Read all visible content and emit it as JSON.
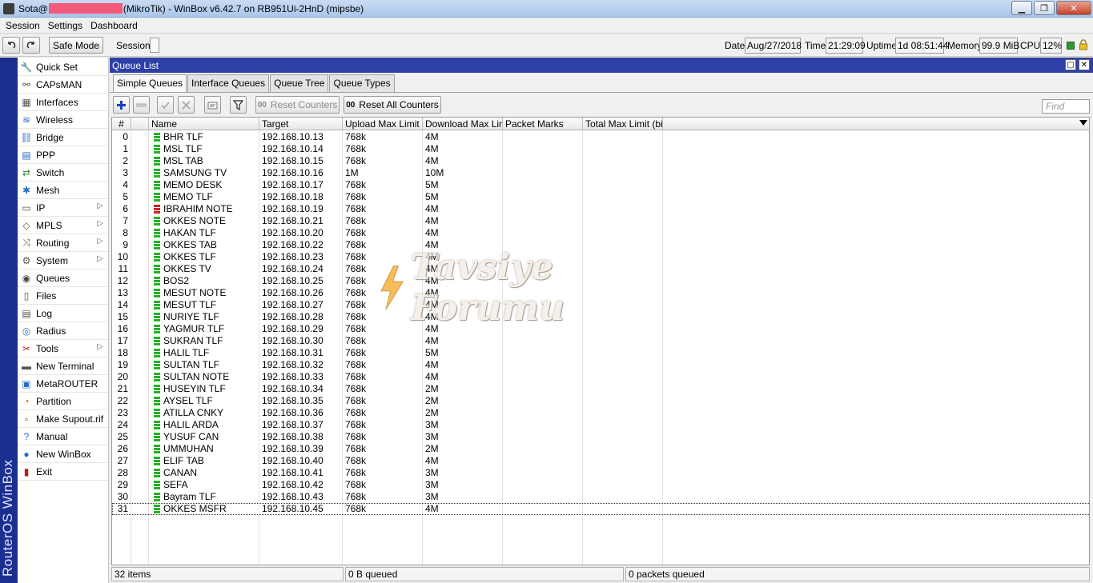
{
  "window": {
    "title_prefix": "Sota@",
    "title_suffix": "(MikroTik) - WinBox v6.42.7 on RB951Ui-2HnD (mipsbe)",
    "controls": [
      "minimize",
      "maximize",
      "close"
    ]
  },
  "menu": [
    "Session",
    "Settings",
    "Dashboard"
  ],
  "toolbar": {
    "safe_mode": "Safe Mode",
    "session_label": "Session:",
    "date_label": "Date:",
    "date": "Aug/27/2018",
    "time_label": "Time:",
    "time": "21:29:09",
    "uptime_label": "Uptime:",
    "uptime": "1d 08:51:44",
    "memory_label": "Memory:",
    "memory": "99.9 MiB",
    "cpu_label": "CPU:",
    "cpu": "12%"
  },
  "brand": "RouterOS WinBox",
  "sidebar": [
    {
      "label": "Quick Set",
      "icon": "quick-set-icon",
      "submenu": false
    },
    {
      "label": "CAPsMAN",
      "icon": "capsman-icon",
      "submenu": false
    },
    {
      "label": "Interfaces",
      "icon": "interfaces-icon",
      "submenu": false
    },
    {
      "label": "Wireless",
      "icon": "wireless-icon",
      "submenu": false
    },
    {
      "label": "Bridge",
      "icon": "bridge-icon",
      "submenu": false
    },
    {
      "label": "PPP",
      "icon": "ppp-icon",
      "submenu": false
    },
    {
      "label": "Switch",
      "icon": "switch-icon",
      "submenu": false
    },
    {
      "label": "Mesh",
      "icon": "mesh-icon",
      "submenu": false
    },
    {
      "label": "IP",
      "icon": "ip-icon",
      "submenu": true
    },
    {
      "label": "MPLS",
      "icon": "mpls-icon",
      "submenu": true
    },
    {
      "label": "Routing",
      "icon": "routing-icon",
      "submenu": true
    },
    {
      "label": "System",
      "icon": "system-icon",
      "submenu": true
    },
    {
      "label": "Queues",
      "icon": "queues-icon",
      "submenu": false
    },
    {
      "label": "Files",
      "icon": "files-icon",
      "submenu": false
    },
    {
      "label": "Log",
      "icon": "log-icon",
      "submenu": false
    },
    {
      "label": "Radius",
      "icon": "radius-icon",
      "submenu": false
    },
    {
      "label": "Tools",
      "icon": "tools-icon",
      "submenu": true
    },
    {
      "label": "New Terminal",
      "icon": "terminal-icon",
      "submenu": false
    },
    {
      "label": "MetaROUTER",
      "icon": "metarouter-icon",
      "submenu": false
    },
    {
      "label": "Partition",
      "icon": "partition-icon",
      "submenu": false
    },
    {
      "label": "Make Supout.rif",
      "icon": "supout-icon",
      "submenu": false
    },
    {
      "label": "Manual",
      "icon": "manual-icon",
      "submenu": false
    },
    {
      "label": "New WinBox",
      "icon": "winbox-icon",
      "submenu": false
    },
    {
      "label": "Exit",
      "icon": "exit-icon",
      "submenu": false
    }
  ],
  "queue_window": {
    "title": "Queue List",
    "tabs": [
      "Simple Queues",
      "Interface Queues",
      "Queue Tree",
      "Queue Types"
    ],
    "active_tab": "Simple Queues",
    "reset_counters": "Reset Counters",
    "reset_all_counters": "Reset All Counters",
    "counter_glyph": "00",
    "find_placeholder": "Find",
    "columns": [
      "#",
      "Name",
      "Target",
      "Upload Max Limit",
      "Download Max Limit",
      "Packet Marks",
      "Total Max Limit (bi..."
    ],
    "rows": [
      {
        "n": "0",
        "name": "BHR TLF",
        "target": "192.168.10.13",
        "up": "768k",
        "down": "4M",
        "status": "green"
      },
      {
        "n": "1",
        "name": "MSL TLF",
        "target": "192.168.10.14",
        "up": "768k",
        "down": "4M",
        "status": "green"
      },
      {
        "n": "2",
        "name": "MSL TAB",
        "target": "192.168.10.15",
        "up": "768k",
        "down": "4M",
        "status": "green"
      },
      {
        "n": "3",
        "name": "SAMSUNG TV",
        "target": "192.168.10.16",
        "up": "1M",
        "down": "10M",
        "status": "green"
      },
      {
        "n": "4",
        "name": "MEMO DESK",
        "target": "192.168.10.17",
        "up": "768k",
        "down": "5M",
        "status": "green"
      },
      {
        "n": "5",
        "name": "MEMO TLF",
        "target": "192.168.10.18",
        "up": "768k",
        "down": "5M",
        "status": "green"
      },
      {
        "n": "6",
        "name": "IBRAHIM NOTE",
        "target": "192.168.10.19",
        "up": "768k",
        "down": "4M",
        "status": "red"
      },
      {
        "n": "7",
        "name": "OKKES NOTE",
        "target": "192.168.10.21",
        "up": "768k",
        "down": "4M",
        "status": "green"
      },
      {
        "n": "8",
        "name": "HAKAN TLF",
        "target": "192.168.10.20",
        "up": "768k",
        "down": "4M",
        "status": "green"
      },
      {
        "n": "9",
        "name": "OKKES TAB",
        "target": "192.168.10.22",
        "up": "768k",
        "down": "4M",
        "status": "green"
      },
      {
        "n": "10",
        "name": "OKKES TLF",
        "target": "192.168.10.23",
        "up": "768k",
        "down": "4M",
        "status": "green"
      },
      {
        "n": "11",
        "name": "OKKES TV",
        "target": "192.168.10.24",
        "up": "768k",
        "down": "4M",
        "status": "green"
      },
      {
        "n": "12",
        "name": "BOS2",
        "target": "192.168.10.25",
        "up": "768k",
        "down": "4M",
        "status": "green"
      },
      {
        "n": "13",
        "name": "MESUT NOTE",
        "target": "192.168.10.26",
        "up": "768k",
        "down": "4M",
        "status": "green"
      },
      {
        "n": "14",
        "name": "MESUT TLF",
        "target": "192.168.10.27",
        "up": "768k",
        "down": "4M",
        "status": "green"
      },
      {
        "n": "15",
        "name": "NURIYE TLF",
        "target": "192.168.10.28",
        "up": "768k",
        "down": "4M",
        "status": "green"
      },
      {
        "n": "16",
        "name": "YAGMUR TLF",
        "target": "192.168.10.29",
        "up": "768k",
        "down": "4M",
        "status": "green"
      },
      {
        "n": "17",
        "name": "SUKRAN TLF",
        "target": "192.168.10.30",
        "up": "768k",
        "down": "4M",
        "status": "green"
      },
      {
        "n": "18",
        "name": "HALIL TLF",
        "target": "192.168.10.31",
        "up": "768k",
        "down": "5M",
        "status": "green"
      },
      {
        "n": "19",
        "name": "SULTAN TLF",
        "target": "192.168.10.32",
        "up": "768k",
        "down": "4M",
        "status": "green"
      },
      {
        "n": "20",
        "name": "SULTAN NOTE",
        "target": "192.168.10.33",
        "up": "768k",
        "down": "4M",
        "status": "green"
      },
      {
        "n": "21",
        "name": "HUSEYIN TLF",
        "target": "192.168.10.34",
        "up": "768k",
        "down": "2M",
        "status": "green"
      },
      {
        "n": "22",
        "name": "AYSEL TLF",
        "target": "192.168.10.35",
        "up": "768k",
        "down": "2M",
        "status": "green"
      },
      {
        "n": "23",
        "name": "ATILLA  CNKY",
        "target": "192.168.10.36",
        "up": "768k",
        "down": "2M",
        "status": "green"
      },
      {
        "n": "24",
        "name": "HALIL  ARDA",
        "target": "192.168.10.37",
        "up": "768k",
        "down": "3M",
        "status": "green"
      },
      {
        "n": "25",
        "name": "YUSUF CAN",
        "target": "192.168.10.38",
        "up": "768k",
        "down": "3M",
        "status": "green"
      },
      {
        "n": "26",
        "name": "UMMUHAN",
        "target": "192.168.10.39",
        "up": "768k",
        "down": "2M",
        "status": "green"
      },
      {
        "n": "27",
        "name": "ELIF TAB",
        "target": "192.168.10.40",
        "up": "768k",
        "down": "4M",
        "status": "green"
      },
      {
        "n": "28",
        "name": "CANAN",
        "target": "192.168.10.41",
        "up": "768k",
        "down": "3M",
        "status": "green"
      },
      {
        "n": "29",
        "name": "SEFA",
        "target": "192.168.10.42",
        "up": "768k",
        "down": "3M",
        "status": "green"
      },
      {
        "n": "30",
        "name": "Bayram TLF",
        "target": "192.168.10.43",
        "up": "768k",
        "down": "3M",
        "status": "green"
      },
      {
        "n": "31",
        "name": "OKKES MSFR",
        "target": "192.168.10.45",
        "up": "768k",
        "down": "4M",
        "status": "green"
      }
    ],
    "status_items": "32 items",
    "status_queued": "0 B queued",
    "status_packets": "0 packets queued"
  },
  "watermark": "Tavsiye Forumu",
  "colors": {
    "titlebar": "#2e3fa7",
    "brand_strip": "#1b2f8f",
    "status_green": "#22b422",
    "status_red": "#d42020",
    "add_blue": "#1a3fc2"
  }
}
